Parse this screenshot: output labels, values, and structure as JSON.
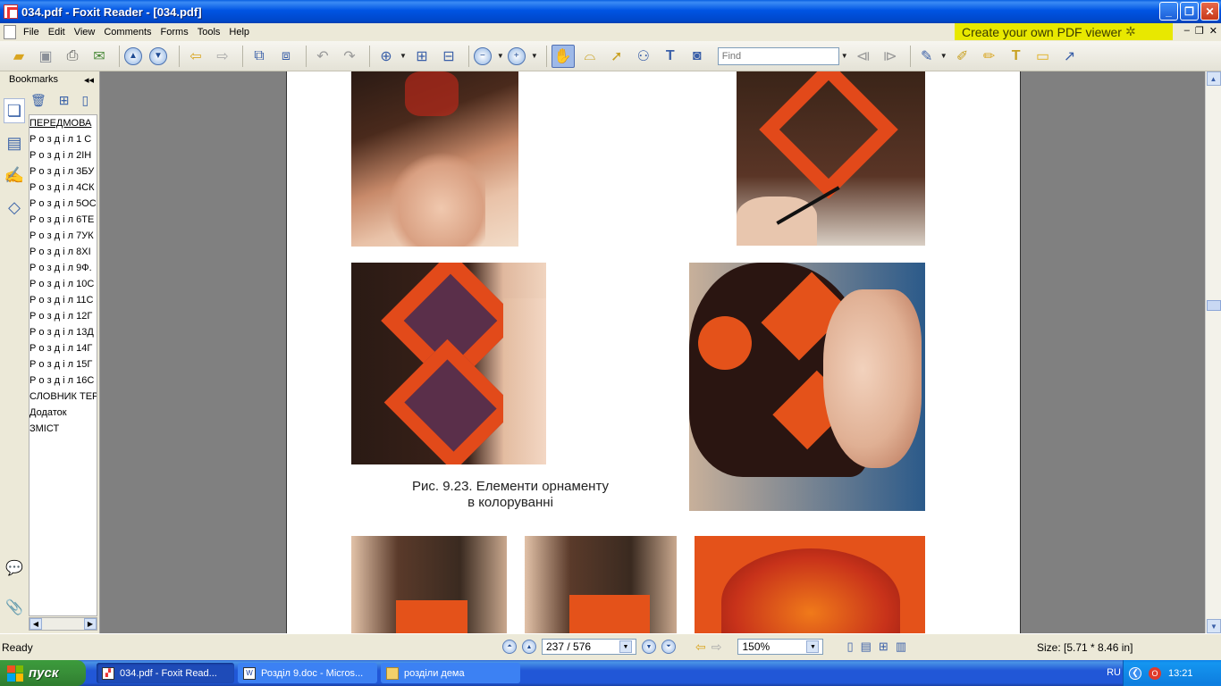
{
  "window": {
    "title": "034.pdf - Foxit Reader - [034.pdf]",
    "buttons": {
      "minimize": "_",
      "restore": "❐",
      "close": "✕"
    }
  },
  "menu": {
    "items": [
      "File",
      "Edit",
      "View",
      "Comments",
      "Forms",
      "Tools",
      "Help"
    ],
    "promo": "Create your own PDF viewer",
    "mdi": {
      "minimize": "–",
      "restore": "❐",
      "close": "✕"
    }
  },
  "toolbar": {
    "find_placeholder": "Find"
  },
  "bookmarks": {
    "header": "Bookmarks",
    "collapse": "◂◂",
    "items": [
      "ПЕРЕДМОВА",
      "Р о з д і л 1 С",
      "Р о з д і л 2ІН",
      "Р о з д і л 3БУ",
      "Р о з д і л 4СК",
      "Р о з д і л 5ОС",
      "Р о з д і л 6ТЕ",
      "Р о з д і л 7УК",
      "Р о з д і л 8ХІ",
      "Р о з д і л 9Ф.",
      "Р о з д і л 10С",
      "Р о з д і л 11С",
      "Р о з д і л 12Г",
      "Р о з д і л 13Д",
      "Р о з д і л 14Г",
      "Р о з д і л 15Г",
      "Р о з д і л 16С",
      "СЛОВНИК ТЕР",
      "Додаток",
      "ЗМІСТ"
    ]
  },
  "document": {
    "caption_line1": "Рис. 9.23. Елементи орнаменту",
    "caption_line2": "в колоруванні"
  },
  "status": {
    "ready": "Ready",
    "page": "237 / 576",
    "zoom": "150%",
    "size": "Size: [5.71 * 8.46 in]"
  },
  "taskbar": {
    "start": "пуск",
    "tasks": [
      {
        "label": "034.pdf - Foxit Read...",
        "active": true
      },
      {
        "label": "Розділ 9.doc - Micros...",
        "active": false
      },
      {
        "label": "розділи дема",
        "active": false
      }
    ],
    "lang": "RU",
    "clock": "13:21"
  },
  "colors": {
    "titlebar": "#0054e3",
    "promo_bg": "#e8e800",
    "page_bg": "#ffffff",
    "viewer_bg": "#808080"
  }
}
